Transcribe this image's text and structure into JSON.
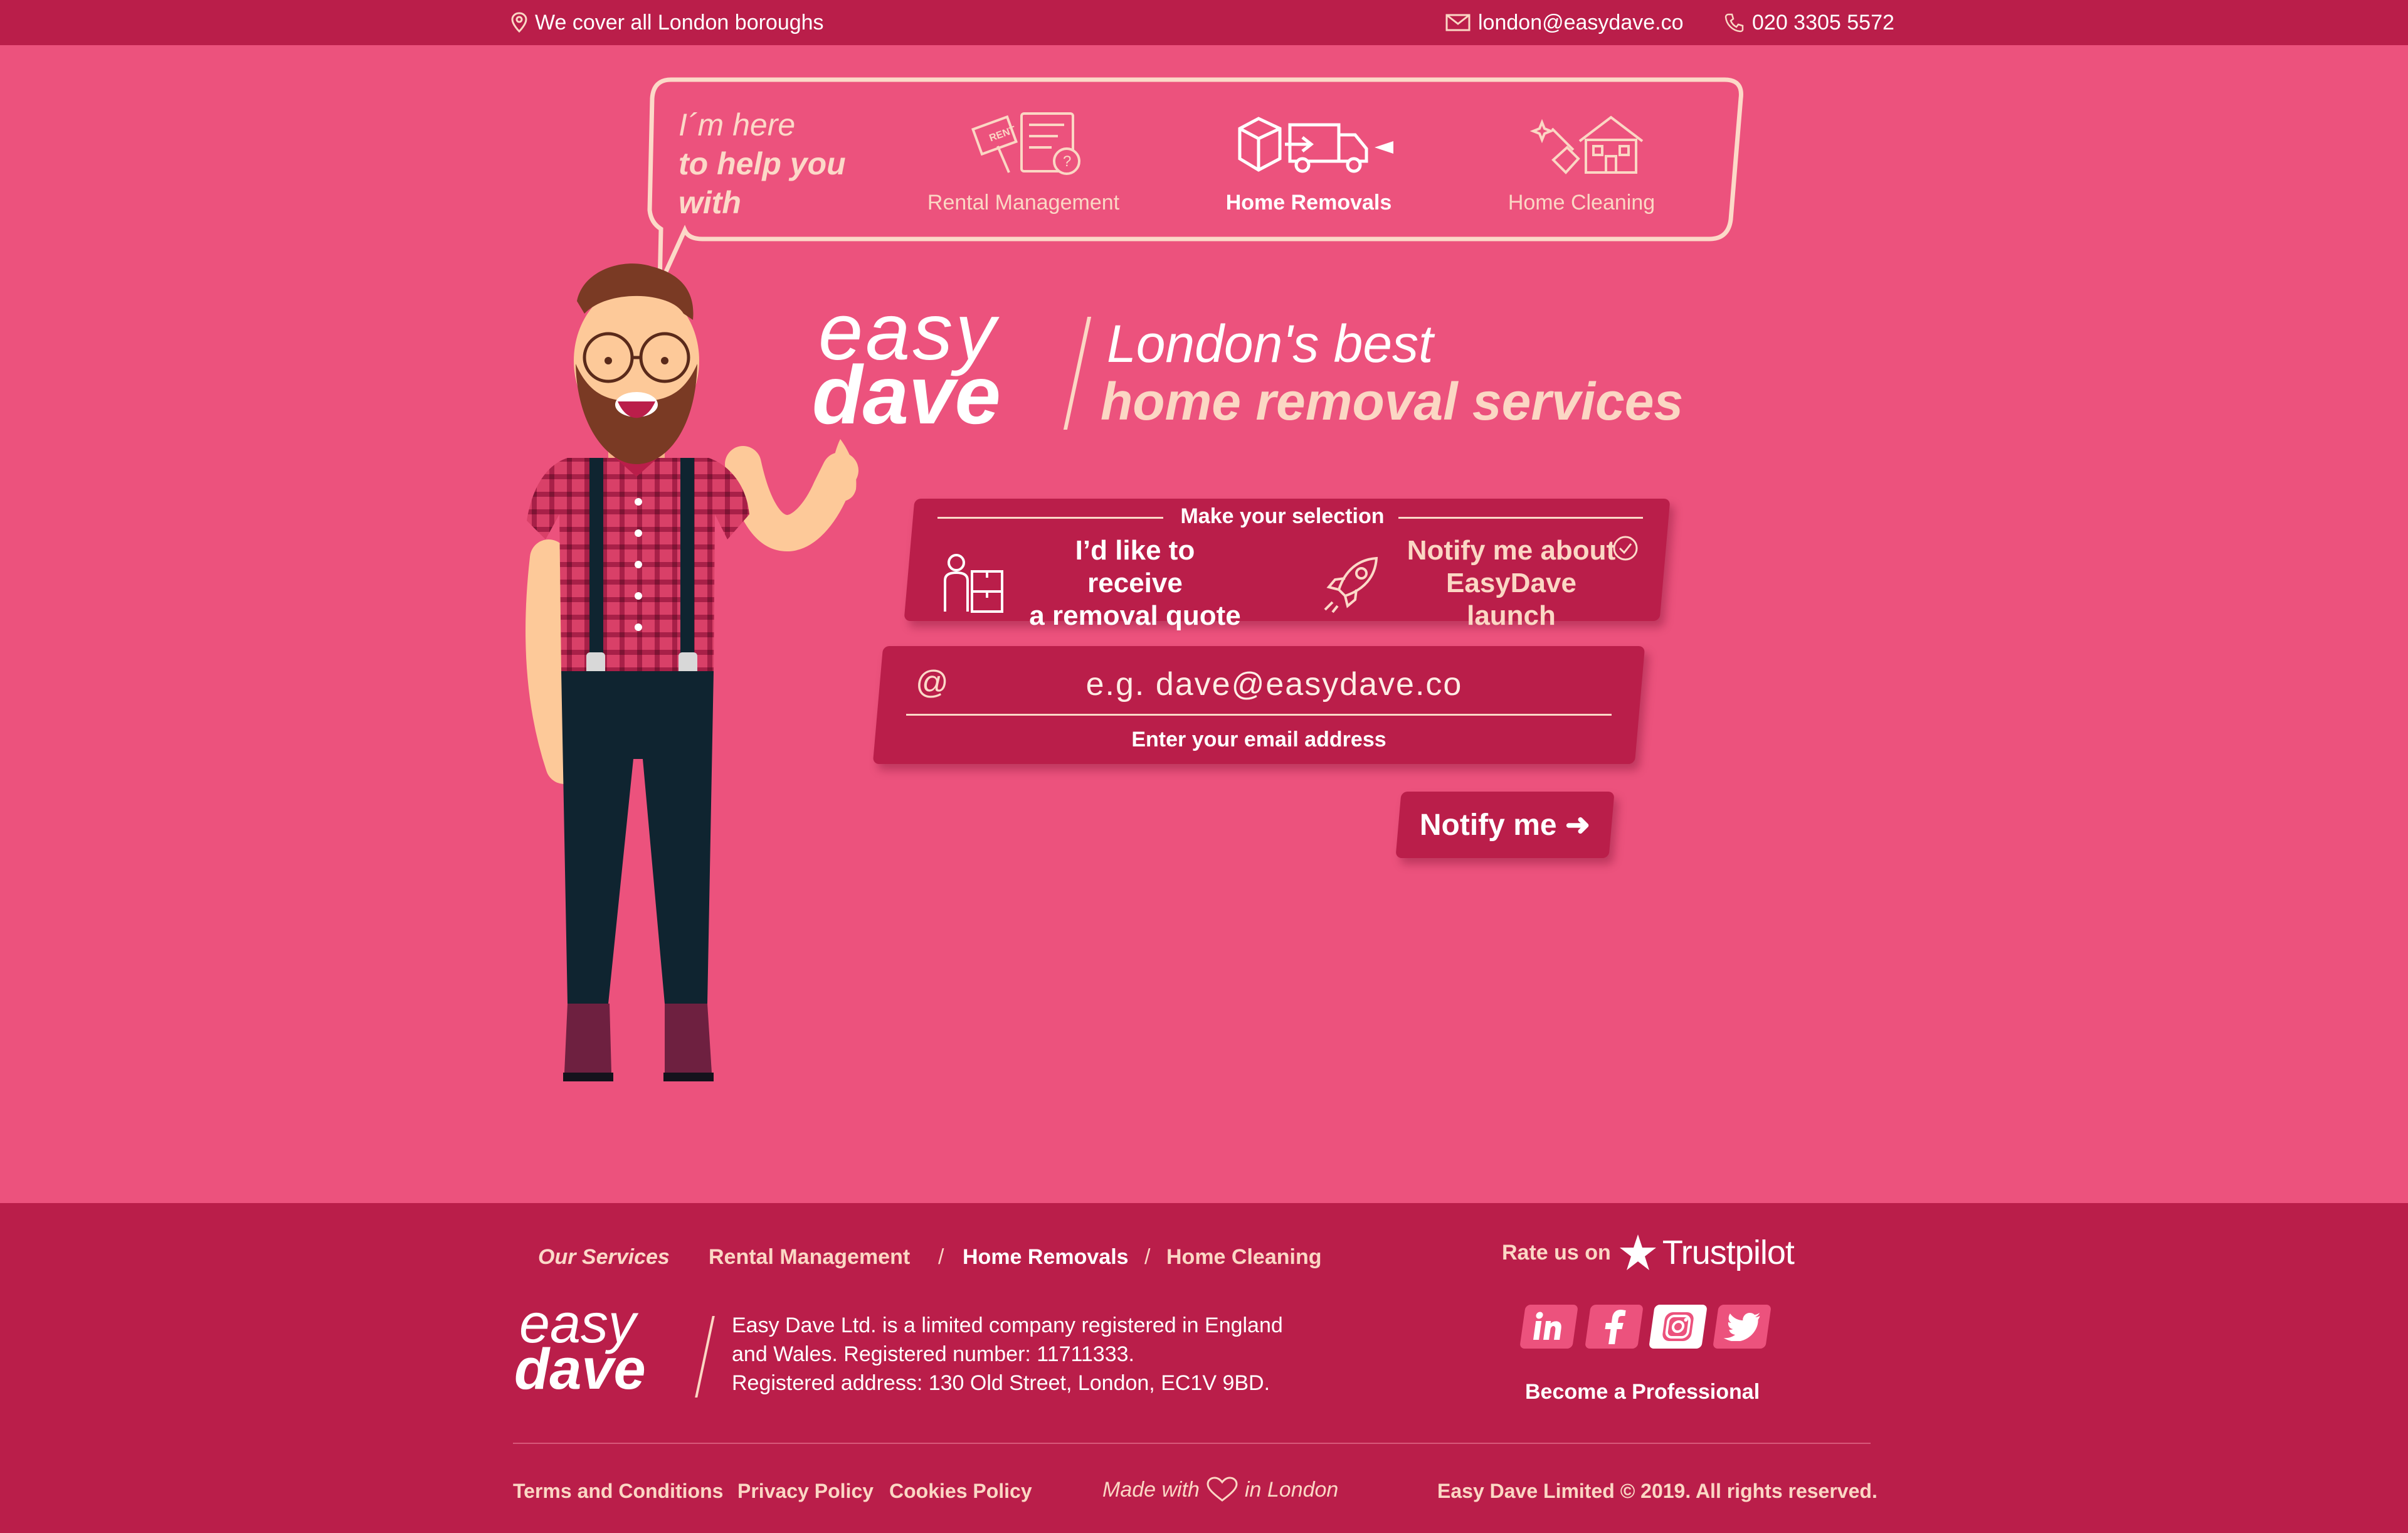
{
  "topbar": {
    "location": "We cover all London boroughs",
    "email": "london@easydave.co",
    "phone": "020 3305 5572"
  },
  "bubble": {
    "intro_1": "I´m here",
    "intro_2": "to help you",
    "intro_3": "with",
    "services": [
      {
        "label": "Rental Management",
        "icon": "rent-sign-icon",
        "active": false
      },
      {
        "label": "Home Removals",
        "icon": "moving-truck-icon",
        "active": true
      },
      {
        "label": "Home Cleaning",
        "icon": "house-cleaning-icon",
        "active": false
      }
    ]
  },
  "brand": {
    "logo_easy": "easy",
    "logo_dave": "dave",
    "tagline_1": "London's best",
    "tagline_2": "home removal services"
  },
  "selection": {
    "title": "Make your selection",
    "option_quote_1": "I’d like to receive",
    "option_quote_2": "a removal quote",
    "option_launch_1": "Notify me about",
    "option_launch_2": "EasyDave launch"
  },
  "email": {
    "at_symbol": "@",
    "placeholder": "e.g. dave@easydave.co",
    "caption": "Enter your email address"
  },
  "notify": {
    "label": "Notify me ➜"
  },
  "footer": {
    "services_heading": "Our Services",
    "services": [
      "Rental Management",
      "Home Removals",
      "Home Cleaning"
    ],
    "separator": "/",
    "logo_easy": "easy",
    "logo_dave": "dave",
    "company_1": "Easy Dave Ltd. is a limited company registered in England",
    "company_2": "and Wales. Registered number: 11711333.",
    "company_3": "Registered address: 130 Old Street, London, EC1V 9BD.",
    "rate_label": "Rate us on",
    "trustpilot": "Trustpilot",
    "social": [
      "linkedin-icon",
      "facebook-icon",
      "instagram-icon",
      "twitter-icon"
    ],
    "become_professional": "Become a Professional",
    "terms": "Terms and Conditions",
    "privacy": "Privacy Policy",
    "cookies": "Cookies Policy",
    "made_with": "Made with",
    "in_london": "in London",
    "copyright": "Easy Dave Limited © 2019. All rights reserved."
  },
  "colors": {
    "background": "#EC527D",
    "panel": "#BA1E4A",
    "accent": "#FBD7C4"
  }
}
